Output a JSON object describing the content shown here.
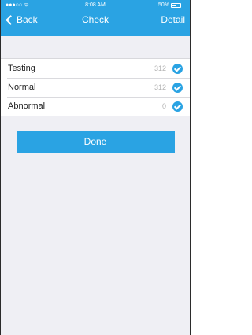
{
  "status_bar": {
    "signal": "●●●○○ ᯤ",
    "time": "8:08 AM",
    "battery": "50%"
  },
  "nav": {
    "back_label": "Back",
    "title": "Check",
    "detail_label": "Detail"
  },
  "rows": [
    {
      "label": "Testing",
      "count": "312"
    },
    {
      "label": "Normal",
      "count": "312"
    },
    {
      "label": "Abnormal",
      "count": "0"
    }
  ],
  "done_label": "Done",
  "colors": {
    "accent": "#2aa3e3",
    "background": "#efeff4"
  }
}
